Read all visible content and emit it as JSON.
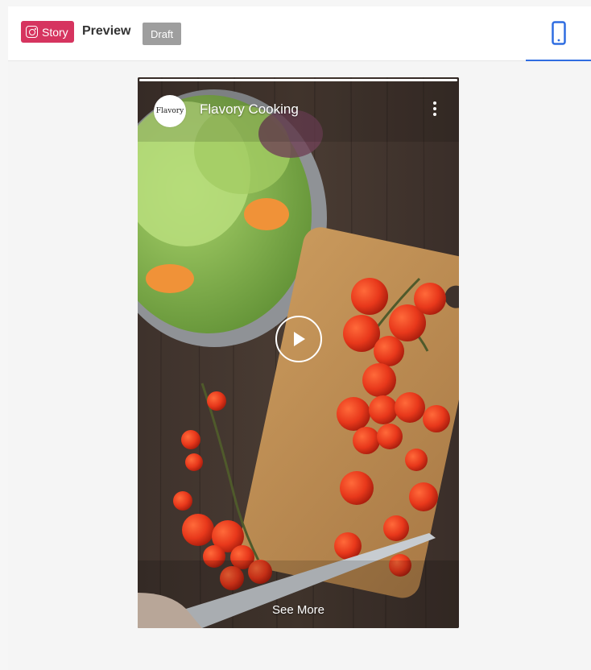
{
  "header": {
    "story_badge": "Story",
    "title": "Preview",
    "status_badge": "Draft",
    "device_tab_icon": "mobile-phone-icon",
    "accent_color": "#2f6de1",
    "story_badge_color": "#d6345f"
  },
  "story": {
    "avatar_text": "Flavory",
    "account_name": "Flavory Cooking",
    "menu_icon": "more-vertical-icon",
    "play_icon": "play-icon",
    "cta": "See More",
    "progress": 1.0
  }
}
